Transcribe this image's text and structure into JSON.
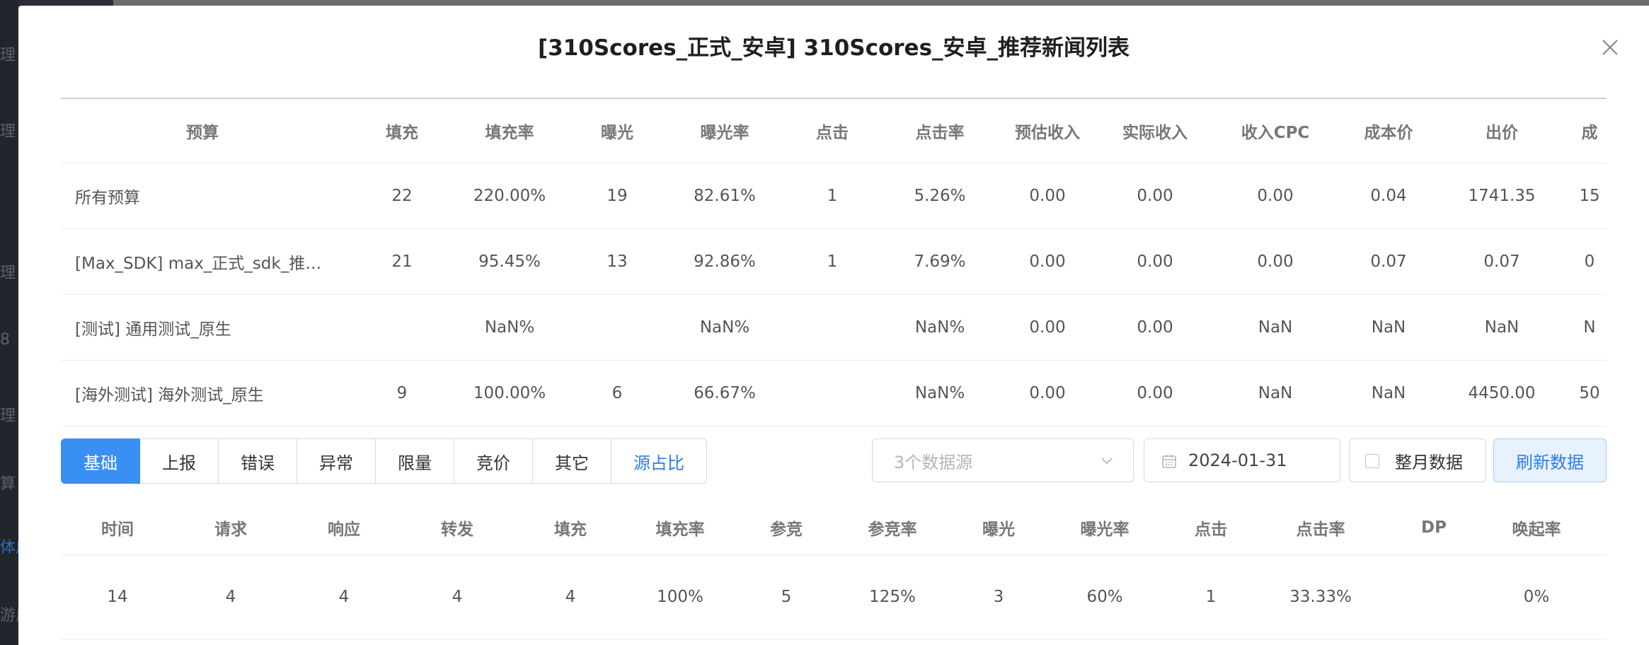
{
  "background": {
    "sidebar_fragments": [
      "理",
      "理",
      "理",
      "8",
      "理",
      "算",
      "体广",
      "游广"
    ]
  },
  "modal": {
    "title": "[310Scores_正式_安卓] 310Scores_安卓_推荐新闻列表",
    "close_icon": "close-icon"
  },
  "budget_table": {
    "columns": [
      "预算",
      "填充",
      "填充率",
      "曝光",
      "曝光率",
      "点击",
      "点击率",
      "预估收入",
      "实际收入",
      "收入CPC",
      "成本价",
      "出价",
      "成"
    ],
    "rows": [
      [
        "所有预算",
        "22",
        "220.00%",
        "19",
        "82.61%",
        "1",
        "5.26%",
        "0.00",
        "0.00",
        "0.00",
        "0.04",
        "1741.35",
        "15"
      ],
      [
        "[Max_SDK] max_正式_sdk_推…",
        "21",
        "95.45%",
        "13",
        "92.86%",
        "1",
        "7.69%",
        "0.00",
        "0.00",
        "0.00",
        "0.07",
        "0.07",
        "0"
      ],
      [
        "[测试] 通用测试_原生",
        "",
        "NaN%",
        "",
        "NaN%",
        "",
        "NaN%",
        "0.00",
        "0.00",
        "NaN",
        "NaN",
        "NaN",
        "N"
      ],
      [
        "[海外测试] 海外测试_原生",
        "9",
        "100.00%",
        "6",
        "66.67%",
        "",
        "NaN%",
        "0.00",
        "0.00",
        "NaN",
        "NaN",
        "4450.00",
        "50"
      ]
    ]
  },
  "toolbar": {
    "tabs": [
      {
        "label": "基础",
        "state": "active"
      },
      {
        "label": "上报",
        "state": "normal"
      },
      {
        "label": "错误",
        "state": "normal"
      },
      {
        "label": "异常",
        "state": "normal"
      },
      {
        "label": "限量",
        "state": "normal"
      },
      {
        "label": "竞价",
        "state": "normal"
      },
      {
        "label": "其它",
        "state": "normal"
      },
      {
        "label": "源占比",
        "state": "link"
      }
    ],
    "source_select_placeholder": "3个数据源",
    "date_value": "2024-01-31",
    "full_month_label": "整月数据",
    "full_month_checked": false,
    "refresh_label": "刷新数据"
  },
  "stats_table": {
    "columns": [
      "时间",
      "请求",
      "响应",
      "转发",
      "填充",
      "填充率",
      "参竞",
      "参竞率",
      "曝光",
      "曝光率",
      "点击",
      "点击率",
      "DP",
      "唤起率"
    ],
    "rows": [
      [
        "14",
        "4",
        "4",
        "4",
        "4",
        "100%",
        "5",
        "125%",
        "3",
        "60%",
        "1",
        "33.33%",
        "",
        "0%"
      ]
    ]
  },
  "colors": {
    "accent": "#3a8ff5",
    "link": "#2a7de6",
    "refresh_bg": "#e8f2fe"
  }
}
